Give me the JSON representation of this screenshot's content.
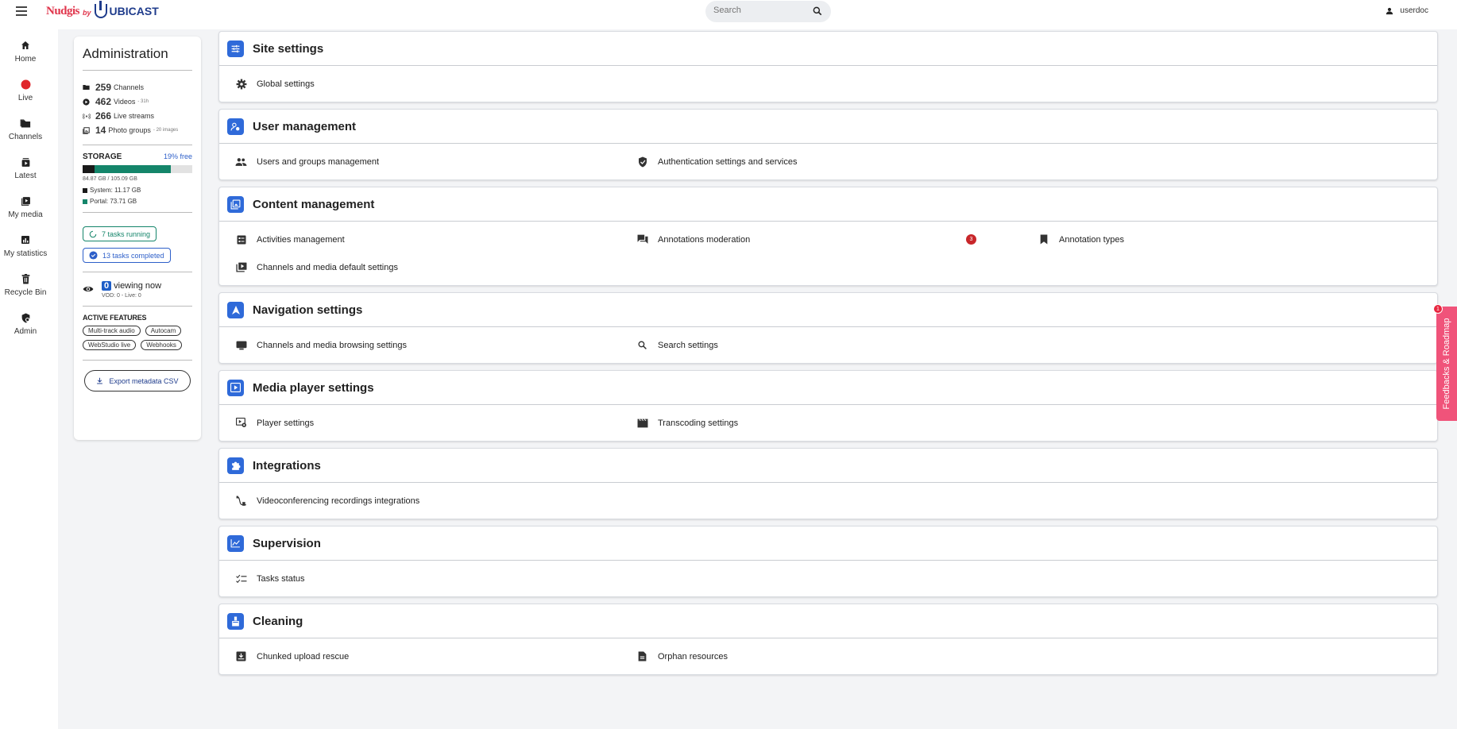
{
  "header": {
    "logo_main": "Nudgis",
    "logo_by": "by",
    "logo_brand": "UBICAST",
    "search_placeholder": "Search",
    "username": "userdoc"
  },
  "nav": {
    "items": [
      {
        "label": "Home",
        "icon": "home-icon"
      },
      {
        "label": "Live",
        "icon": "live-dot-icon"
      },
      {
        "label": "Channels",
        "icon": "folder-icon"
      },
      {
        "label": "Latest",
        "icon": "latest-icon"
      },
      {
        "label": "My media",
        "icon": "my-media-icon"
      },
      {
        "label": "My statistics",
        "icon": "statistics-icon"
      },
      {
        "label": "Recycle Bin",
        "icon": "trash-icon"
      },
      {
        "label": "Admin",
        "icon": "admin-shield-icon"
      }
    ]
  },
  "admin": {
    "title": "Administration",
    "stats": [
      {
        "count": "259",
        "label": "Channels",
        "note": ""
      },
      {
        "count": "462",
        "label": "Videos",
        "note": "- 31h"
      },
      {
        "count": "266",
        "label": "Live streams",
        "note": ""
      },
      {
        "count": "14",
        "label": "Photo groups",
        "note": "- 20 images"
      }
    ],
    "storage": {
      "label": "STORAGE",
      "free": "19% free",
      "total": "84.87 GB / 105.09 GB",
      "system": "System: 11.17 GB",
      "portal": "Portal: 73.71 GB",
      "system_fraction": 0.106,
      "portal_fraction": 0.701,
      "system_color": "#1a1a1a",
      "portal_color": "#14856a"
    },
    "tasks_running": "7 tasks running",
    "tasks_completed": "13 tasks completed",
    "viewing_count": "0",
    "viewing_label": "viewing now",
    "viewing_detail": "VOD: 0 - Live: 0",
    "active_features_title": "ACTIVE FEATURES",
    "features": [
      "Multi-track audio",
      "Autocam",
      "WebStudio live",
      "Webhooks"
    ],
    "export_label": "Export metadata CSV"
  },
  "sections": {
    "site": {
      "title": "Site settings",
      "items": [
        "Global settings"
      ]
    },
    "users": {
      "title": "User management",
      "items": [
        "Users and groups management",
        "Authentication settings and services"
      ]
    },
    "content": {
      "title": "Content management",
      "items": [
        "Activities management",
        "Annotations moderation",
        "Annotation types",
        "Channels and media default settings"
      ],
      "badge": "3"
    },
    "navigation": {
      "title": "Navigation settings",
      "items": [
        "Channels and media browsing settings",
        "Search settings"
      ]
    },
    "player": {
      "title": "Media player settings",
      "items": [
        "Player settings",
        "Transcoding settings"
      ]
    },
    "integrations": {
      "title": "Integrations",
      "items": [
        "Videoconferencing recordings integrations"
      ]
    },
    "supervision": {
      "title": "Supervision",
      "items": [
        "Tasks status"
      ]
    },
    "cleaning": {
      "title": "Cleaning",
      "items": [
        "Chunked upload rescue",
        "Orphan resources"
      ]
    }
  },
  "feedback": {
    "label": "Feedbacks & Roadmap",
    "badge": "1"
  },
  "colors": {
    "accent": "#2f6ad9",
    "brand_red": "#e0344b",
    "brand_blue": "#1f3c8c",
    "live_red": "#e0262b",
    "feedback_pink": "#f0537a"
  }
}
